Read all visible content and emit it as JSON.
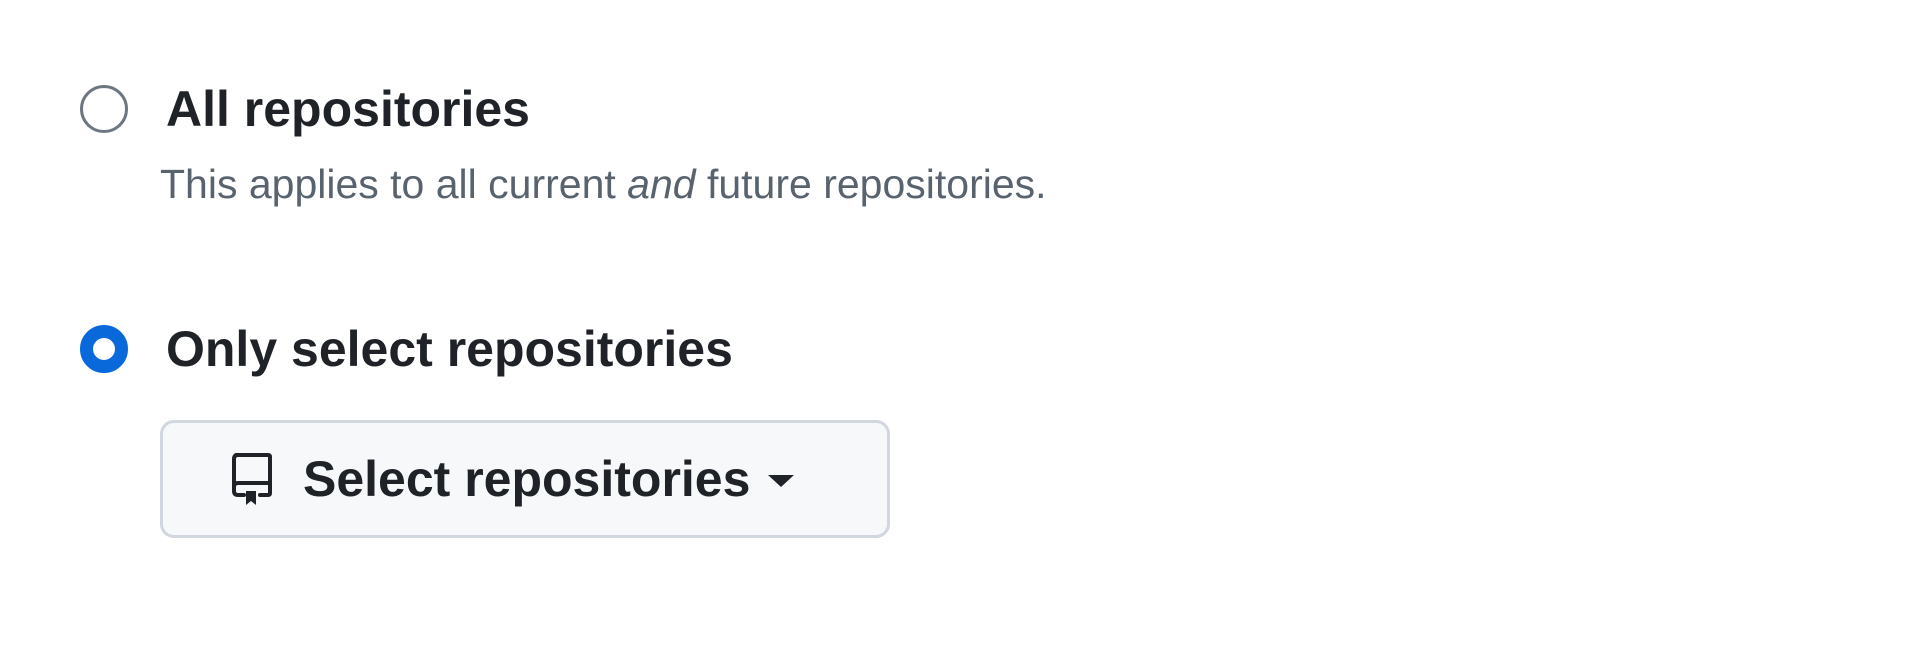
{
  "options": {
    "all": {
      "label": "All repositories",
      "checked": false,
      "description_before": "This applies to all current ",
      "description_emphasis": "and",
      "description_after": " future repositories."
    },
    "select": {
      "label": "Only select repositories",
      "checked": true
    }
  },
  "select_button": {
    "label": "Select repositories",
    "icon": "repo-icon",
    "caret": "caret-down-icon"
  },
  "colors": {
    "accent": "#0969da",
    "text": "#1f2328",
    "muted": "#59636e",
    "button_bg": "#f6f8fa",
    "button_border": "#d0d7de"
  }
}
